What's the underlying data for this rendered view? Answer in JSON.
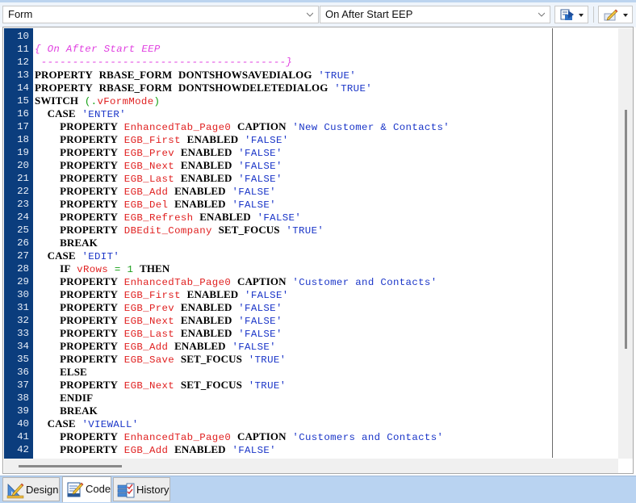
{
  "toolbar": {
    "form_combo": {
      "value": "Form",
      "icon": "chevron-down-icon"
    },
    "event_combo": {
      "value": "On After Start EEP",
      "icon": "chevron-down-icon"
    },
    "buttons": [
      {
        "name": "export-code-button",
        "icon": "export-code-icon"
      },
      {
        "name": "edit-options-button",
        "icon": "pencil-edit-icon"
      }
    ]
  },
  "editor": {
    "lines": [
      {
        "n": "10",
        "tokens": []
      },
      {
        "n": "11",
        "tokens": [
          {
            "t": "cm",
            "v": "{ On After Start EEP"
          }
        ]
      },
      {
        "n": "12",
        "tokens": [
          {
            "t": "cm",
            "v": " ---------------------------------------}"
          }
        ]
      },
      {
        "n": "13",
        "tokens": [
          {
            "t": "kw",
            "v": "PROPERTY"
          },
          {
            "t": "plain",
            "v": " "
          },
          {
            "t": "kw",
            "v": "RBASE_FORM"
          },
          {
            "t": "plain",
            "v": " "
          },
          {
            "t": "kw",
            "v": "DONTSHOWSAVEDIALOG"
          },
          {
            "t": "plain",
            "v": " "
          },
          {
            "t": "str",
            "v": "'TRUE'"
          }
        ]
      },
      {
        "n": "14",
        "tokens": [
          {
            "t": "kw",
            "v": "PROPERTY"
          },
          {
            "t": "plain",
            "v": " "
          },
          {
            "t": "kw",
            "v": "RBASE_FORM"
          },
          {
            "t": "plain",
            "v": " "
          },
          {
            "t": "kw",
            "v": "DONTSHOWDELETEDIALOG"
          },
          {
            "t": "plain",
            "v": " "
          },
          {
            "t": "str",
            "v": "'TRUE'"
          }
        ]
      },
      {
        "n": "15",
        "tokens": [
          {
            "t": "kw",
            "v": "SWITCH"
          },
          {
            "t": "plain",
            "v": " "
          },
          {
            "t": "punc",
            "v": "(."
          },
          {
            "t": "var",
            "v": "vFormMode"
          },
          {
            "t": "punc",
            "v": ")"
          }
        ]
      },
      {
        "n": "16",
        "tokens": [
          {
            "t": "plain",
            "v": "  "
          },
          {
            "t": "kw",
            "v": "CASE"
          },
          {
            "t": "plain",
            "v": " "
          },
          {
            "t": "str",
            "v": "'ENTER'"
          }
        ]
      },
      {
        "n": "17",
        "tokens": [
          {
            "t": "plain",
            "v": "    "
          },
          {
            "t": "kw",
            "v": "PROPERTY"
          },
          {
            "t": "plain",
            "v": " "
          },
          {
            "t": "obj",
            "v": "EnhancedTab_Page0"
          },
          {
            "t": "plain",
            "v": " "
          },
          {
            "t": "kw",
            "v": "CAPTION"
          },
          {
            "t": "plain",
            "v": " "
          },
          {
            "t": "str",
            "v": "'New Customer & Contacts'"
          }
        ]
      },
      {
        "n": "18",
        "tokens": [
          {
            "t": "plain",
            "v": "    "
          },
          {
            "t": "kw",
            "v": "PROPERTY"
          },
          {
            "t": "plain",
            "v": " "
          },
          {
            "t": "obj",
            "v": "EGB_First"
          },
          {
            "t": "plain",
            "v": " "
          },
          {
            "t": "kw",
            "v": "ENABLED"
          },
          {
            "t": "plain",
            "v": " "
          },
          {
            "t": "str",
            "v": "'FALSE'"
          }
        ]
      },
      {
        "n": "19",
        "tokens": [
          {
            "t": "plain",
            "v": "    "
          },
          {
            "t": "kw",
            "v": "PROPERTY"
          },
          {
            "t": "plain",
            "v": " "
          },
          {
            "t": "obj",
            "v": "EGB_Prev"
          },
          {
            "t": "plain",
            "v": " "
          },
          {
            "t": "kw",
            "v": "ENABLED"
          },
          {
            "t": "plain",
            "v": " "
          },
          {
            "t": "str",
            "v": "'FALSE'"
          }
        ]
      },
      {
        "n": "20",
        "tokens": [
          {
            "t": "plain",
            "v": "    "
          },
          {
            "t": "kw",
            "v": "PROPERTY"
          },
          {
            "t": "plain",
            "v": " "
          },
          {
            "t": "obj",
            "v": "EGB_Next"
          },
          {
            "t": "plain",
            "v": " "
          },
          {
            "t": "kw",
            "v": "ENABLED"
          },
          {
            "t": "plain",
            "v": " "
          },
          {
            "t": "str",
            "v": "'FALSE'"
          }
        ]
      },
      {
        "n": "21",
        "tokens": [
          {
            "t": "plain",
            "v": "    "
          },
          {
            "t": "kw",
            "v": "PROPERTY"
          },
          {
            "t": "plain",
            "v": " "
          },
          {
            "t": "obj",
            "v": "EGB_Last"
          },
          {
            "t": "plain",
            "v": " "
          },
          {
            "t": "kw",
            "v": "ENABLED"
          },
          {
            "t": "plain",
            "v": " "
          },
          {
            "t": "str",
            "v": "'FALSE'"
          }
        ]
      },
      {
        "n": "22",
        "tokens": [
          {
            "t": "plain",
            "v": "    "
          },
          {
            "t": "kw",
            "v": "PROPERTY"
          },
          {
            "t": "plain",
            "v": " "
          },
          {
            "t": "obj",
            "v": "EGB_Add"
          },
          {
            "t": "plain",
            "v": " "
          },
          {
            "t": "kw",
            "v": "ENABLED"
          },
          {
            "t": "plain",
            "v": " "
          },
          {
            "t": "str",
            "v": "'FALSE'"
          }
        ]
      },
      {
        "n": "23",
        "tokens": [
          {
            "t": "plain",
            "v": "    "
          },
          {
            "t": "kw",
            "v": "PROPERTY"
          },
          {
            "t": "plain",
            "v": " "
          },
          {
            "t": "obj",
            "v": "EGB_Del"
          },
          {
            "t": "plain",
            "v": " "
          },
          {
            "t": "kw",
            "v": "ENABLED"
          },
          {
            "t": "plain",
            "v": " "
          },
          {
            "t": "str",
            "v": "'FALSE'"
          }
        ]
      },
      {
        "n": "24",
        "tokens": [
          {
            "t": "plain",
            "v": "    "
          },
          {
            "t": "kw",
            "v": "PROPERTY"
          },
          {
            "t": "plain",
            "v": " "
          },
          {
            "t": "obj",
            "v": "EGB_Refresh"
          },
          {
            "t": "plain",
            "v": " "
          },
          {
            "t": "kw",
            "v": "ENABLED"
          },
          {
            "t": "plain",
            "v": " "
          },
          {
            "t": "str",
            "v": "'FALSE'"
          }
        ]
      },
      {
        "n": "25",
        "tokens": [
          {
            "t": "plain",
            "v": "    "
          },
          {
            "t": "kw",
            "v": "PROPERTY"
          },
          {
            "t": "plain",
            "v": " "
          },
          {
            "t": "obj",
            "v": "DBEdit_Company"
          },
          {
            "t": "plain",
            "v": " "
          },
          {
            "t": "kw",
            "v": "SET_FOCUS"
          },
          {
            "t": "plain",
            "v": " "
          },
          {
            "t": "str",
            "v": "'TRUE'"
          }
        ]
      },
      {
        "n": "26",
        "tokens": [
          {
            "t": "plain",
            "v": "    "
          },
          {
            "t": "kw",
            "v": "BREAK"
          }
        ]
      },
      {
        "n": "27",
        "tokens": [
          {
            "t": "plain",
            "v": "  "
          },
          {
            "t": "kw",
            "v": "CASE"
          },
          {
            "t": "plain",
            "v": " "
          },
          {
            "t": "str",
            "v": "'EDIT'"
          }
        ]
      },
      {
        "n": "28",
        "tokens": [
          {
            "t": "plain",
            "v": "    "
          },
          {
            "t": "kw",
            "v": "IF"
          },
          {
            "t": "plain",
            "v": " "
          },
          {
            "t": "var",
            "v": "vRows"
          },
          {
            "t": "plain",
            "v": " "
          },
          {
            "t": "punc",
            "v": "="
          },
          {
            "t": "plain",
            "v": " "
          },
          {
            "t": "num",
            "v": "1"
          },
          {
            "t": "plain",
            "v": " "
          },
          {
            "t": "kw",
            "v": "THEN"
          }
        ]
      },
      {
        "n": "29",
        "tokens": [
          {
            "t": "plain",
            "v": "    "
          },
          {
            "t": "kw",
            "v": "PROPERTY"
          },
          {
            "t": "plain",
            "v": " "
          },
          {
            "t": "obj",
            "v": "EnhancedTab_Page0"
          },
          {
            "t": "plain",
            "v": " "
          },
          {
            "t": "kw",
            "v": "CAPTION"
          },
          {
            "t": "plain",
            "v": " "
          },
          {
            "t": "str",
            "v": "'Customer and Contacts'"
          }
        ]
      },
      {
        "n": "30",
        "tokens": [
          {
            "t": "plain",
            "v": "    "
          },
          {
            "t": "kw",
            "v": "PROPERTY"
          },
          {
            "t": "plain",
            "v": " "
          },
          {
            "t": "obj",
            "v": "EGB_First"
          },
          {
            "t": "plain",
            "v": " "
          },
          {
            "t": "kw",
            "v": "ENABLED"
          },
          {
            "t": "plain",
            "v": " "
          },
          {
            "t": "str",
            "v": "'FALSE'"
          }
        ]
      },
      {
        "n": "31",
        "tokens": [
          {
            "t": "plain",
            "v": "    "
          },
          {
            "t": "kw",
            "v": "PROPERTY"
          },
          {
            "t": "plain",
            "v": " "
          },
          {
            "t": "obj",
            "v": "EGB_Prev"
          },
          {
            "t": "plain",
            "v": " "
          },
          {
            "t": "kw",
            "v": "ENABLED"
          },
          {
            "t": "plain",
            "v": " "
          },
          {
            "t": "str",
            "v": "'FALSE'"
          }
        ]
      },
      {
        "n": "32",
        "tokens": [
          {
            "t": "plain",
            "v": "    "
          },
          {
            "t": "kw",
            "v": "PROPERTY"
          },
          {
            "t": "plain",
            "v": " "
          },
          {
            "t": "obj",
            "v": "EGB_Next"
          },
          {
            "t": "plain",
            "v": " "
          },
          {
            "t": "kw",
            "v": "ENABLED"
          },
          {
            "t": "plain",
            "v": " "
          },
          {
            "t": "str",
            "v": "'FALSE'"
          }
        ]
      },
      {
        "n": "33",
        "tokens": [
          {
            "t": "plain",
            "v": "    "
          },
          {
            "t": "kw",
            "v": "PROPERTY"
          },
          {
            "t": "plain",
            "v": " "
          },
          {
            "t": "obj",
            "v": "EGB_Last"
          },
          {
            "t": "plain",
            "v": " "
          },
          {
            "t": "kw",
            "v": "ENABLED"
          },
          {
            "t": "plain",
            "v": " "
          },
          {
            "t": "str",
            "v": "'FALSE'"
          }
        ]
      },
      {
        "n": "34",
        "tokens": [
          {
            "t": "plain",
            "v": "    "
          },
          {
            "t": "kw",
            "v": "PROPERTY"
          },
          {
            "t": "plain",
            "v": " "
          },
          {
            "t": "obj",
            "v": "EGB_Add"
          },
          {
            "t": "plain",
            "v": " "
          },
          {
            "t": "kw",
            "v": "ENABLED"
          },
          {
            "t": "plain",
            "v": " "
          },
          {
            "t": "str",
            "v": "'FALSE'"
          }
        ]
      },
      {
        "n": "35",
        "tokens": [
          {
            "t": "plain",
            "v": "    "
          },
          {
            "t": "kw",
            "v": "PROPERTY"
          },
          {
            "t": "plain",
            "v": " "
          },
          {
            "t": "obj",
            "v": "EGB_Save"
          },
          {
            "t": "plain",
            "v": " "
          },
          {
            "t": "kw",
            "v": "SET_FOCUS"
          },
          {
            "t": "plain",
            "v": " "
          },
          {
            "t": "str",
            "v": "'TRUE'"
          }
        ]
      },
      {
        "n": "36",
        "tokens": [
          {
            "t": "plain",
            "v": "    "
          },
          {
            "t": "kw",
            "v": "ELSE"
          }
        ]
      },
      {
        "n": "37",
        "tokens": [
          {
            "t": "plain",
            "v": "    "
          },
          {
            "t": "kw",
            "v": "PROPERTY"
          },
          {
            "t": "plain",
            "v": " "
          },
          {
            "t": "obj",
            "v": "EGB_Next"
          },
          {
            "t": "plain",
            "v": " "
          },
          {
            "t": "kw",
            "v": "SET_FOCUS"
          },
          {
            "t": "plain",
            "v": " "
          },
          {
            "t": "str",
            "v": "'TRUE'"
          }
        ]
      },
      {
        "n": "38",
        "tokens": [
          {
            "t": "plain",
            "v": "    "
          },
          {
            "t": "kw",
            "v": "ENDIF"
          }
        ]
      },
      {
        "n": "39",
        "tokens": [
          {
            "t": "plain",
            "v": "    "
          },
          {
            "t": "kw",
            "v": "BREAK"
          }
        ]
      },
      {
        "n": "40",
        "tokens": [
          {
            "t": "plain",
            "v": "  "
          },
          {
            "t": "kw",
            "v": "CASE"
          },
          {
            "t": "plain",
            "v": " "
          },
          {
            "t": "str",
            "v": "'VIEWALL'"
          }
        ]
      },
      {
        "n": "41",
        "tokens": [
          {
            "t": "plain",
            "v": "    "
          },
          {
            "t": "kw",
            "v": "PROPERTY"
          },
          {
            "t": "plain",
            "v": " "
          },
          {
            "t": "obj",
            "v": "EnhancedTab_Page0"
          },
          {
            "t": "plain",
            "v": " "
          },
          {
            "t": "kw",
            "v": "CAPTION"
          },
          {
            "t": "plain",
            "v": " "
          },
          {
            "t": "str",
            "v": "'Customers and Contacts'"
          }
        ]
      },
      {
        "n": "42",
        "tokens": [
          {
            "t": "plain",
            "v": "    "
          },
          {
            "t": "kw",
            "v": "PROPERTY"
          },
          {
            "t": "plain",
            "v": " "
          },
          {
            "t": "obj",
            "v": "EGB_Add"
          },
          {
            "t": "plain",
            "v": " "
          },
          {
            "t": "kw",
            "v": "ENABLED"
          },
          {
            "t": "plain",
            "v": " "
          },
          {
            "t": "str",
            "v": "'FALSE'"
          }
        ]
      }
    ],
    "vertical_scroll_fraction": 0.25,
    "horizontal_scroll_fraction": 0.0
  },
  "tabs": [
    {
      "label": "Design",
      "icon": "design-tools-icon",
      "active": false
    },
    {
      "label": "Code",
      "icon": "code-edit-icon",
      "active": true
    },
    {
      "label": "History",
      "icon": "history-checklist-icon",
      "active": false
    }
  ],
  "colors": {
    "gutter": "#0b3d7d",
    "keyword": "#000000",
    "object": "#e02020",
    "string": "#1a35c8",
    "comment": "#e040e0",
    "number": "#20a020",
    "tabbar": "#b9d3f1"
  }
}
